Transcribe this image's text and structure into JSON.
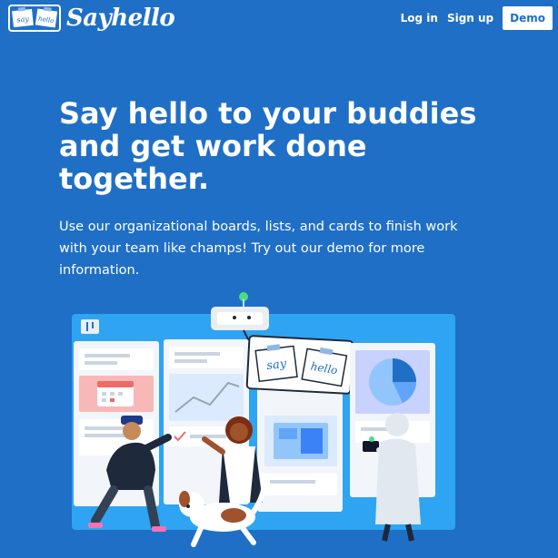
{
  "header": {
    "logo_text": "Sayhello",
    "logo_tile_1": "say",
    "logo_tile_2": "hello",
    "nav": {
      "login_label": "Log in",
      "signup_label": "Sign up",
      "demo_label": "Demo"
    }
  },
  "hero": {
    "title": "Say hello to your buddies and get work done together.",
    "subtitle": "Use our organizational boards, lists, and cards to finish work with your team like champs! Try out our demo for more information."
  },
  "illustration": {
    "board_sign_1": "say",
    "board_sign_2": "hello"
  },
  "colors": {
    "background": "#1f6fc6",
    "board": "#2ea4f2",
    "card": "#f2f6fb",
    "accent_green": "#4ade80",
    "demo_text": "#1f6fc6"
  },
  "icons": [
    "board-logo-icon",
    "robot-icon",
    "calendar-icon",
    "line-chart-icon",
    "pie-chart-icon",
    "check-icon",
    "dog-icon"
  ]
}
